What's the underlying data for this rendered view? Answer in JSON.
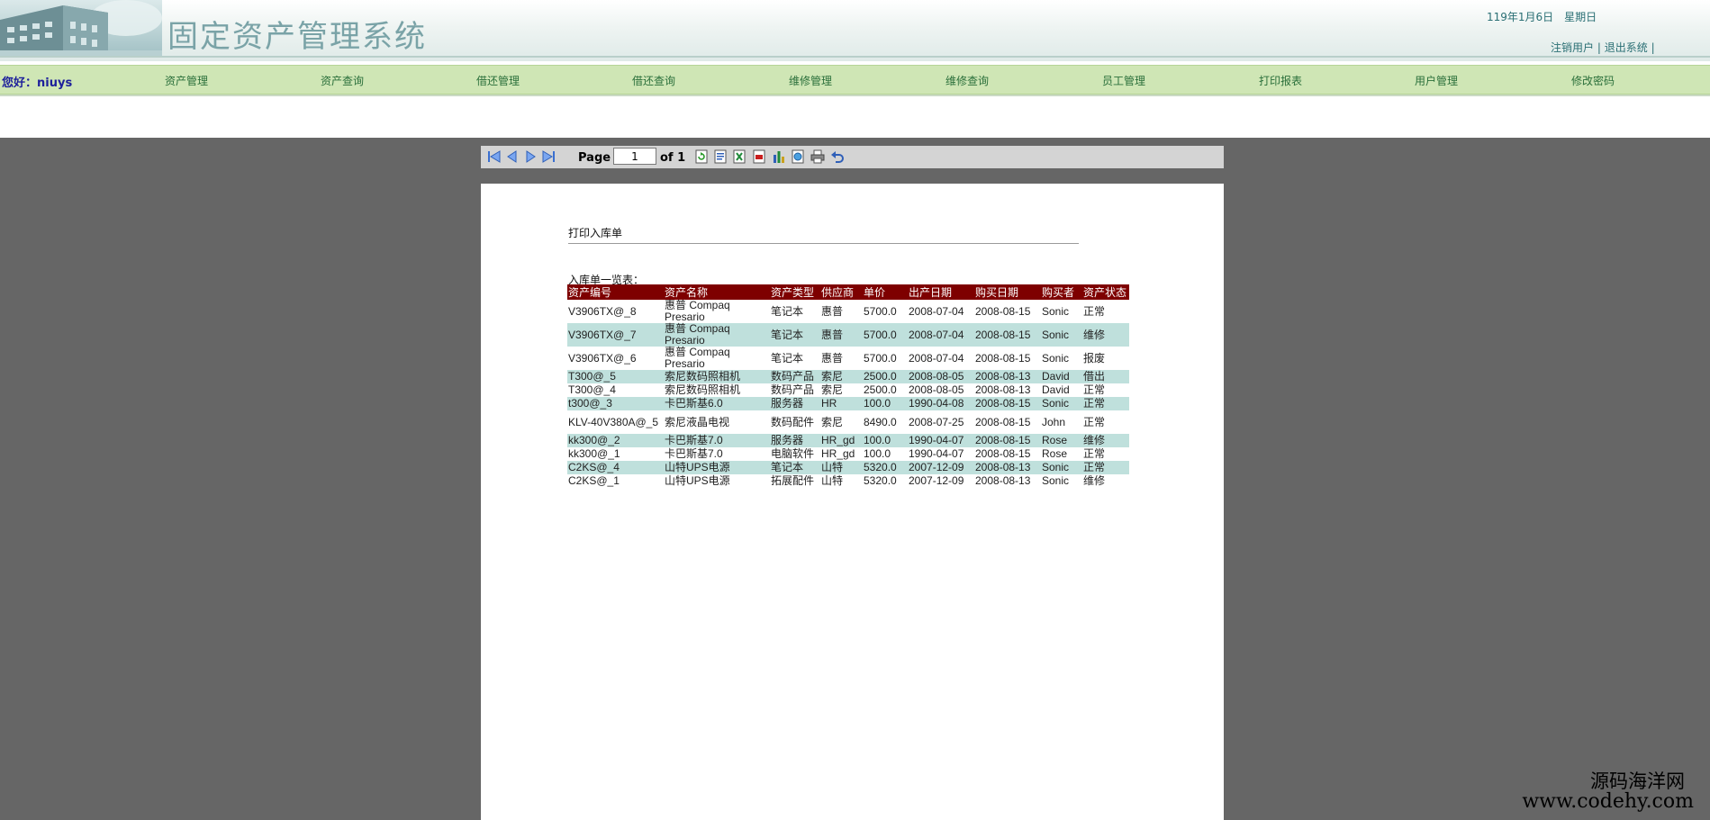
{
  "header": {
    "app_title": "固定资产管理系统",
    "date": "119年1月6日　星期日",
    "logout_user": "注销用户",
    "exit_system": "退出系统",
    "separator": "|"
  },
  "nav": {
    "greeting": "您好：niuys",
    "items": [
      "资产管理",
      "资产查询",
      "借还管理",
      "借还查询",
      "维修管理",
      "维修查询",
      "员工管理",
      "打印报表",
      "用户管理",
      "修改密码"
    ]
  },
  "toolbar": {
    "page_label": "Page",
    "page_value": "1",
    "of_label": "of 1"
  },
  "report": {
    "title": "打印入库单",
    "list_caption": "入库单一览表：",
    "columns": [
      "资产编号",
      "资产名称",
      "资产类型",
      "供应商",
      "单价",
      "出产日期",
      "购买日期",
      "购买者",
      "资产状态"
    ],
    "rows": [
      [
        "V3906TX@_8",
        "惠普 Compaq Presario",
        "笔记本",
        "惠普",
        "5700.0",
        "2008-07-04",
        "2008-08-15",
        "Sonic",
        "正常"
      ],
      [
        "V3906TX@_7",
        "惠普 Compaq Presario",
        "笔记本",
        "惠普",
        "5700.0",
        "2008-07-04",
        "2008-08-15",
        "Sonic",
        "维修"
      ],
      [
        "V3906TX@_6",
        "惠普 Compaq Presario",
        "笔记本",
        "惠普",
        "5700.0",
        "2008-07-04",
        "2008-08-15",
        "Sonic",
        "报废"
      ],
      [
        "T300@_5",
        "索尼数码照相机",
        "数码产品",
        "索尼",
        "2500.0",
        "2008-08-05",
        "2008-08-13",
        "David",
        "借出"
      ],
      [
        "T300@_4",
        "索尼数码照相机",
        "数码产品",
        "索尼",
        "2500.0",
        "2008-08-05",
        "2008-08-13",
        "David",
        "正常"
      ],
      [
        "t300@_3",
        "卡巴斯基6.0",
        "服务器",
        "HR",
        "100.0",
        "1990-04-08",
        "2008-08-15",
        "Sonic",
        "正常"
      ],
      [
        "KLV-40V380A@_5",
        "索尼液晶电视",
        "数码配件",
        "索尼",
        "8490.0",
        "2008-07-25",
        "2008-08-15",
        "John",
        "正常"
      ],
      [
        "kk300@_2",
        "卡巴斯基7.0",
        "服务器",
        "HR_gd",
        "100.0",
        "1990-04-07",
        "2008-08-15",
        "Rose",
        "维修"
      ],
      [
        "kk300@_1",
        "卡巴斯基7.0",
        "电脑软件",
        "HR_gd",
        "100.0",
        "1990-04-07",
        "2008-08-15",
        "Rose",
        "正常"
      ],
      [
        "C2KS@_4",
        "山特UPS电源",
        "笔记本",
        "山特",
        "5320.0",
        "2007-12-09",
        "2008-08-13",
        "Sonic",
        "正常"
      ],
      [
        "C2KS@_1",
        "山特UPS电源",
        "拓展配件",
        "山特",
        "5320.0",
        "2007-12-09",
        "2008-08-13",
        "Sonic",
        "维修"
      ]
    ]
  },
  "watermark": {
    "line1": "源码海洋网",
    "line2": "www.codehy.com"
  }
}
